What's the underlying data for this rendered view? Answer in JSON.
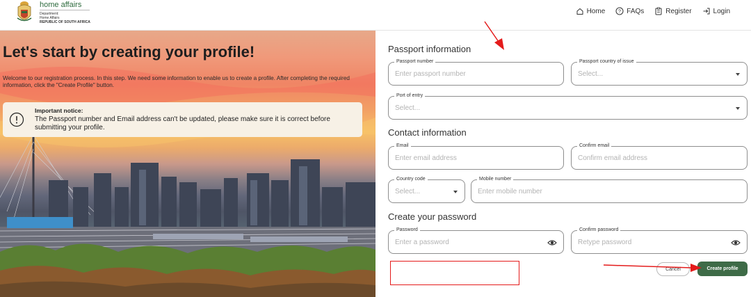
{
  "header": {
    "brand_title": "home affairs",
    "brand_sub_1": "Department:",
    "brand_sub_2": "Home Affairs",
    "brand_sub_3": "REPUBLIC OF SOUTH AFRICA",
    "nav": {
      "home": "Home",
      "faqs": "FAQs",
      "register": "Register",
      "login": "Login"
    }
  },
  "hero": {
    "title": "Let's start by creating your profile!",
    "intro": "Welcome to our registration process. In this step. We need some information to enable us to create a profile. After completing the required information, click the \"Create Profile\" button.",
    "notice_title": "Important notice:",
    "notice_body": "The Passport number and Email address can't be updated, please make sure it is correct before submitting your profile."
  },
  "form": {
    "passport_section": "Passport information",
    "passport_number": {
      "label": "Passport number",
      "placeholder": "Enter passport number"
    },
    "passport_country": {
      "label": "Passport country of issue",
      "value": "Select..."
    },
    "port_of_entry": {
      "label": "Port of entry",
      "value": "Select..."
    },
    "contact_section": "Contact information",
    "email": {
      "label": "Email",
      "placeholder": "Enter email address"
    },
    "confirm_email": {
      "label": "Confirm email",
      "placeholder": "Confirm email address"
    },
    "country_code": {
      "label": "Country code",
      "value": "Select..."
    },
    "mobile_number": {
      "label": "Mobile number",
      "placeholder": "Enter mobile number"
    },
    "password_section": "Create your password",
    "password": {
      "label": "Password",
      "placeholder": "Enter a password"
    },
    "confirm_password": {
      "label": "Confirm password",
      "placeholder": "Retype password"
    },
    "cancel_label": "Cancel",
    "create_label": "Create profile"
  },
  "colors": {
    "brand_green": "#3e6b47",
    "notice_bg": "#f7f1e6",
    "annotation_red": "#e41b1b"
  },
  "icons": [
    "home-icon",
    "question-circle-icon",
    "register-icon",
    "login-icon",
    "exclamation-circle-icon",
    "eye-icon",
    "caret-down-icon"
  ]
}
